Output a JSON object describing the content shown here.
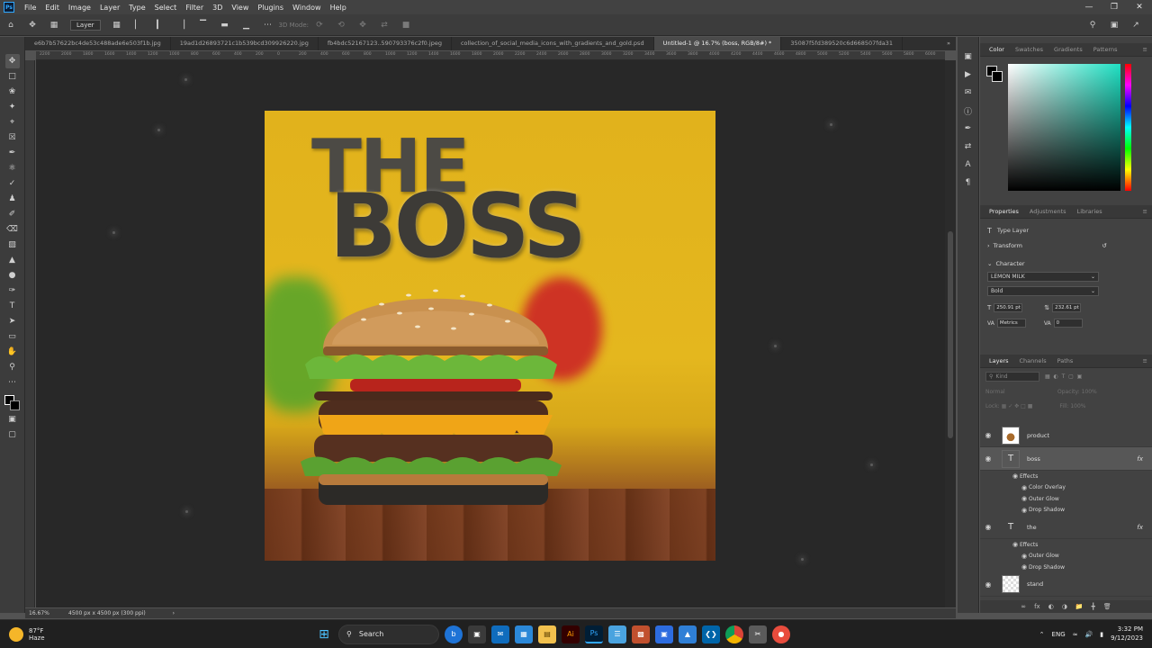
{
  "menubar": {
    "app_logo": "Ps",
    "items": [
      "File",
      "Edit",
      "Image",
      "Layer",
      "Type",
      "Select",
      "Filter",
      "3D",
      "View",
      "Plugins",
      "Window",
      "Help"
    ]
  },
  "optionsbar": {
    "layer_select": "Layer",
    "mode_3d": "3D Mode:"
  },
  "tabs": [
    {
      "label": "e6b7b57622bc4de53c488ade6e503f1b.jpg"
    },
    {
      "label": "19ad1d26893721c1b539bcd309926220.jpg"
    },
    {
      "label": "fb4bdc52167123..590793376c2f0.jpeg"
    },
    {
      "label": "collection_of_social_media_icons_with_gradients_and_gold.psd"
    },
    {
      "label": "Untitled-1 @ 16.7% (boss, RGB/8#) *"
    },
    {
      "label": "35087f5fd389520c6d668507fda31"
    }
  ],
  "ruler_ticks": [
    "2200",
    "2000",
    "1800",
    "1600",
    "1400",
    "1200",
    "1000",
    "800",
    "600",
    "400",
    "200",
    "0",
    "200",
    "400",
    "600",
    "800",
    "1000",
    "1200",
    "1400",
    "1600",
    "1800",
    "2000",
    "2200",
    "2400",
    "2600",
    "2800",
    "3000",
    "3200",
    "3400",
    "3600",
    "3800",
    "4000",
    "4200",
    "4400",
    "4600",
    "4800",
    "5000",
    "5200",
    "5400",
    "5600",
    "5800",
    "6000",
    "6200"
  ],
  "artwork": {
    "word_the": "THE",
    "word_boss": "BOSS"
  },
  "color_panel": {
    "tabs": [
      "Color",
      "Swatches",
      "Gradients",
      "Patterns"
    ],
    "field_color": "#1fe0c3"
  },
  "properties": {
    "tabs": [
      "Properties",
      "Adjustments",
      "Libraries"
    ],
    "layer_type": "Type Layer",
    "transform": "Transform",
    "character": "Character",
    "font_family": "LEMON MILK",
    "font_style": "Bold",
    "font_size": "250.91 pt",
    "leading": "232.61 pt",
    "kerning": "Metrics",
    "tracking": "0"
  },
  "layers": {
    "tabs": [
      "Layers",
      "Channels",
      "Paths"
    ],
    "filter_kind": "Kind",
    "blend_mode": "Normal",
    "opacity_label": "Opacity:",
    "opacity_value": "100%",
    "lock_label": "Lock:",
    "fill_label": "Fill:",
    "fill_value": "100%",
    "items": [
      {
        "name": "product"
      },
      {
        "name": "boss",
        "effects_label": "Effects",
        "effects": [
          "Color Overlay",
          "Outer Glow",
          "Drop Shadow"
        ]
      },
      {
        "name": "the",
        "effects_label": "Effects",
        "effects": [
          "Outer Glow",
          "Drop Shadow"
        ]
      },
      {
        "name": "stand"
      }
    ]
  },
  "statusbar": {
    "zoom": "16.67%",
    "doc_size": "4500 px x 4500 px (300 ppi)"
  },
  "taskbar": {
    "temperature": "87°F",
    "condition": "Haze",
    "search_placeholder": "Search",
    "lang": "ENG",
    "time": "3:32 PM",
    "date": "9/12/2023"
  },
  "colors": {
    "background_yellow": "#e2b31d",
    "text_dark": "#3d3b37",
    "accent_blue": "#31a8ff"
  }
}
